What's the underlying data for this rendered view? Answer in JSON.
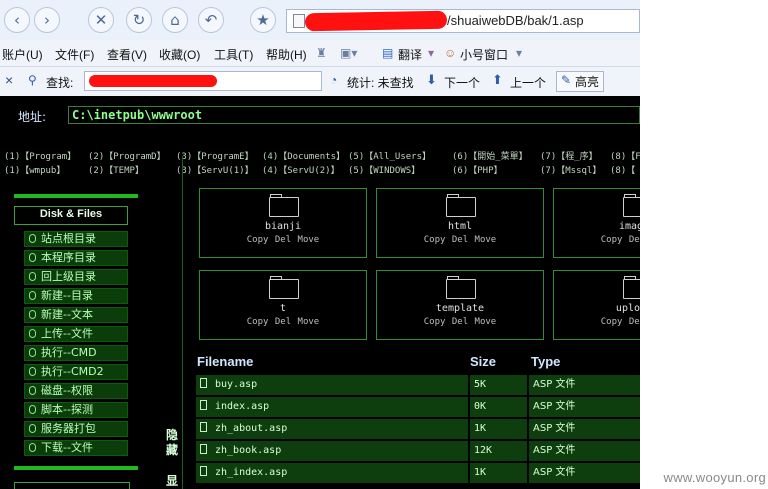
{
  "browser": {
    "nav": {
      "back": "‹",
      "forward": "›",
      "stop": "✕",
      "refresh": "↻",
      "home": "⌂",
      "undo": "↶",
      "favorite": "★"
    },
    "address_visible": "/shuaiwebDB/bak/1.asp",
    "menu": [
      {
        "label": "账户(U)"
      },
      {
        "label": "文件(F)"
      },
      {
        "label": "查看(V)"
      },
      {
        "label": "收藏(O)"
      },
      {
        "label": "工具(T)"
      },
      {
        "label": "帮助(H)"
      }
    ],
    "translate": "翻译",
    "small_window": "小号窗口",
    "findbar": {
      "close": "×",
      "find_label": "查找:",
      "stats": "统计: 未查找",
      "next": "下一个",
      "prev": "上一个",
      "highlight": "高亮"
    }
  },
  "page": {
    "path_label": "地址:",
    "path_value": "C:\\inetpub\\wwwroot",
    "quick_row1": [
      "(1)【Program】",
      "(2)【ProgramD】",
      "(3)【ProgramE】",
      "(4)【Documents】",
      "(5)【All_Users】",
      "(6)【開始_菜單】",
      "(7)【程_序】",
      "(8)【F"
    ],
    "quick_row2": [
      "(1)【wmpub】",
      "(2)【TEMP】",
      "(3)【ServU(1)】",
      "(4)【ServU(2)】",
      "(5)【WINDOWS】",
      "(6)【PHP】",
      "(7)【Mssql】",
      "(8)【"
    ],
    "sidebar": {
      "title": "Disk & Files",
      "items": [
        "站点根目录",
        "本程序目录",
        "回上级目录",
        "新建--目录",
        "新建--文本",
        "上传--文件",
        "执行--CMD",
        "执行--CMD2",
        "磁盘--权限",
        "脚本--探测",
        "服务器打包",
        "下载--文件"
      ],
      "vertical_1": "隐藏",
      "vertical_2": "显"
    },
    "folders": [
      {
        "name": "bianji",
        "actions": "Copy Del Move"
      },
      {
        "name": "html",
        "actions": "Copy Del Move"
      },
      {
        "name": "images",
        "actions": "Copy Del Move"
      },
      {
        "name": "t",
        "actions": "Copy Del Move"
      },
      {
        "name": "template",
        "actions": "Copy Del Move"
      },
      {
        "name": "uploads",
        "actions": "Copy Del Move"
      }
    ],
    "table": {
      "headers": {
        "name": "Filename",
        "size": "Size",
        "type": "Type"
      },
      "rows": [
        {
          "name": "buy.asp",
          "size": "5K",
          "type": "ASP 文件"
        },
        {
          "name": "index.asp",
          "size": "0K",
          "type": "ASP 文件"
        },
        {
          "name": "zh_about.asp",
          "size": "1K",
          "type": "ASP 文件"
        },
        {
          "name": "zh_book.asp",
          "size": "12K",
          "type": "ASP 文件"
        },
        {
          "name": "zh_index.asp",
          "size": "1K",
          "type": "ASP 文件"
        }
      ]
    }
  },
  "watermark": "www.wooyun.org"
}
